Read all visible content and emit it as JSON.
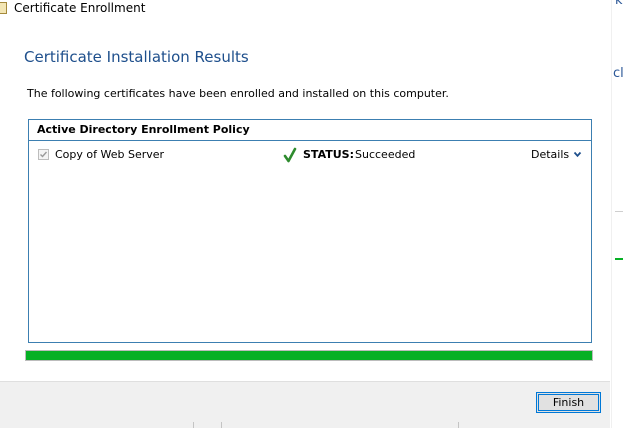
{
  "window": {
    "title": "Certificate Enrollment"
  },
  "page": {
    "heading": "Certificate Installation Results",
    "description": "The following certificates have been enrolled and installed on this computer."
  },
  "policy": {
    "name": "Active Directory Enrollment Policy",
    "certificates": [
      {
        "name": "Copy of Web Server",
        "checked": true,
        "status_label": "STATUS:",
        "status_value": "Succeeded",
        "details_label": "Details"
      }
    ]
  },
  "progress": {
    "percent": 100,
    "color": "#06b025"
  },
  "footer": {
    "finish_label": "Finish"
  },
  "background_window": {
    "glyph_top": "k",
    "glyph_mid": "cl"
  },
  "colors": {
    "accent": "#1e4f8c",
    "panel_border": "#3c7fb1",
    "button_border": "#0078d7"
  },
  "icons": [
    "certificate-icon",
    "checkbox-checked-icon",
    "success-checkmark-icon",
    "chevron-down-icon"
  ]
}
